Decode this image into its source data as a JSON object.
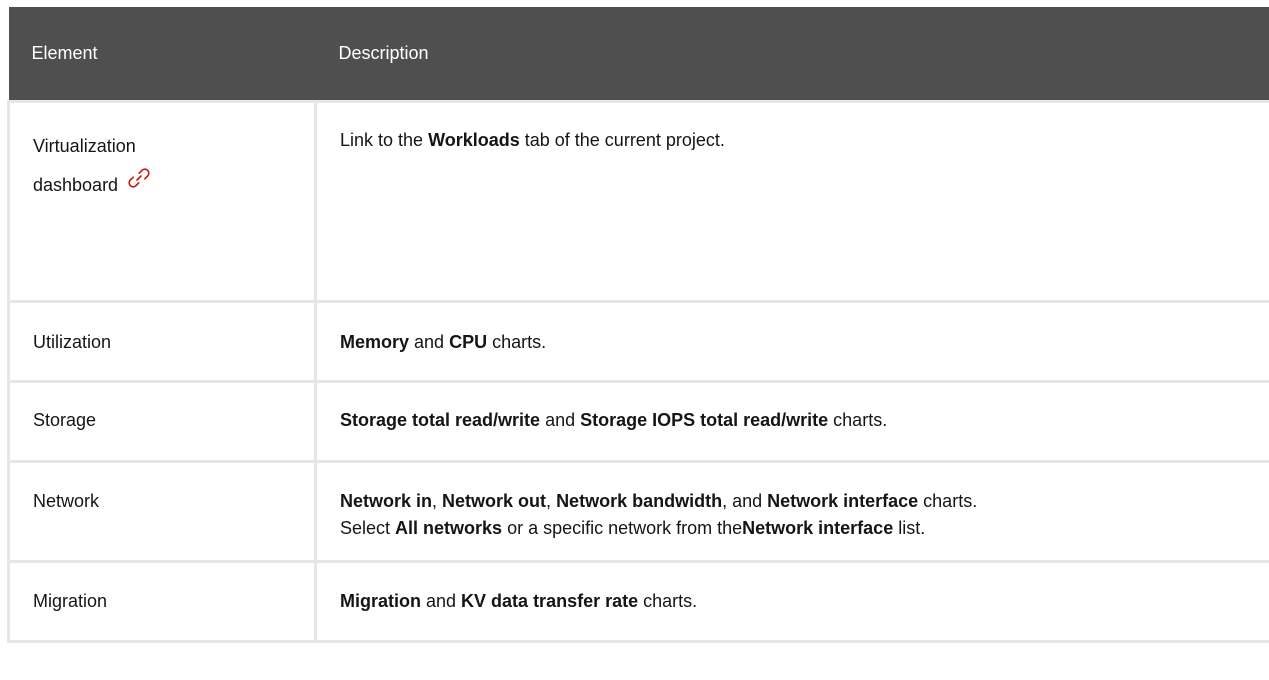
{
  "header": {
    "col_element": "Element",
    "col_description": "Description"
  },
  "rows": [
    {
      "element_line1": "Virtualization",
      "element_line2": "dashboard",
      "icon": "link-icon",
      "icon_color": "#c9190b",
      "desc": [
        {
          "t": "Link to the ",
          "b": false
        },
        {
          "t": "Workloads",
          "b": true
        },
        {
          "t": " tab of the current project.",
          "b": false
        }
      ]
    },
    {
      "element": "Utilization",
      "desc": [
        {
          "t": "Memory",
          "b": true
        },
        {
          "t": " and ",
          "b": false
        },
        {
          "t": "CPU",
          "b": true
        },
        {
          "t": " charts.",
          "b": false
        }
      ]
    },
    {
      "element": "Storage",
      "desc": [
        {
          "t": "Storage total read/write",
          "b": true
        },
        {
          "t": " and ",
          "b": false
        },
        {
          "t": "Storage IOPS total read/write",
          "b": true
        },
        {
          "t": " charts.",
          "b": false
        }
      ]
    },
    {
      "element": "Network",
      "desc_line1": [
        {
          "t": "Network in",
          "b": true
        },
        {
          "t": ", ",
          "b": false
        },
        {
          "t": "Network out",
          "b": true
        },
        {
          "t": ", ",
          "b": false
        },
        {
          "t": "Network bandwidth",
          "b": true
        },
        {
          "t": ", and ",
          "b": false
        },
        {
          "t": "Network interface",
          "b": true
        },
        {
          "t": " charts.",
          "b": false
        }
      ],
      "desc_line2": [
        {
          "t": "Select ",
          "b": false
        },
        {
          "t": "All networks",
          "b": true
        },
        {
          "t": " or a specific network from the",
          "b": false
        },
        {
          "t": "Network interface",
          "b": true
        },
        {
          "t": " list.",
          "b": false
        }
      ]
    },
    {
      "element": "Migration",
      "desc": [
        {
          "t": "Migration",
          "b": true
        },
        {
          "t": " and ",
          "b": false
        },
        {
          "t": "KV data transfer rate",
          "b": true
        },
        {
          "t": " charts.",
          "b": false
        }
      ]
    }
  ]
}
